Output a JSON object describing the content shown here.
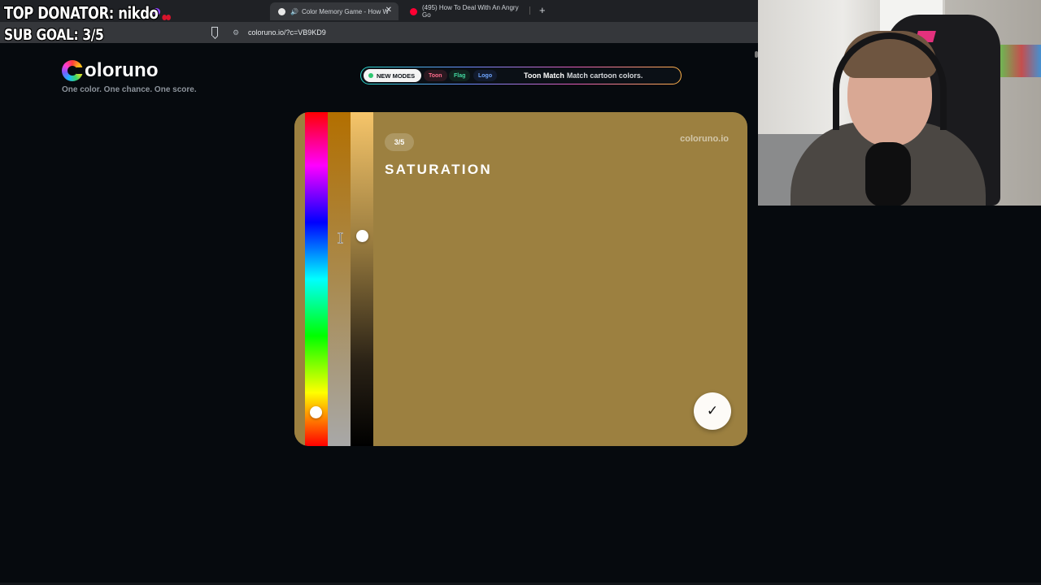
{
  "browser": {
    "tabs": [
      {
        "title": "",
        "favicon_color": "#9146ff"
      },
      {
        "title": "Color Memory Game - How W",
        "favicon_color": "#e8e8e8",
        "active": true
      },
      {
        "title": "(495) How To Deal With An Angry Go",
        "favicon_color": "#ff0033"
      }
    ],
    "close_symbol": "✕",
    "new_tab_symbol": "+",
    "url": "coloruno.io/?c=VB9KD9"
  },
  "overlay": {
    "top_donator": "TOP DONATOR: nikdo",
    "sub_goal": "SUB GOAL: 3/5"
  },
  "site": {
    "logo_text": "oloruno",
    "tagline": "One color. One chance. One score."
  },
  "modes": {
    "badge": "NEW MODES",
    "chips": [
      "Toon",
      "Flag",
      "Logo"
    ],
    "featured_title": "Toon Match",
    "featured_desc": "Match cartoon colors."
  },
  "game": {
    "round": "3/5",
    "title": "SATURATION",
    "brand": "coloruno.io",
    "submit_symbol": "✓",
    "current_color": "#9c8040",
    "hue_level": 0.9,
    "lightness_level": 0.37
  }
}
